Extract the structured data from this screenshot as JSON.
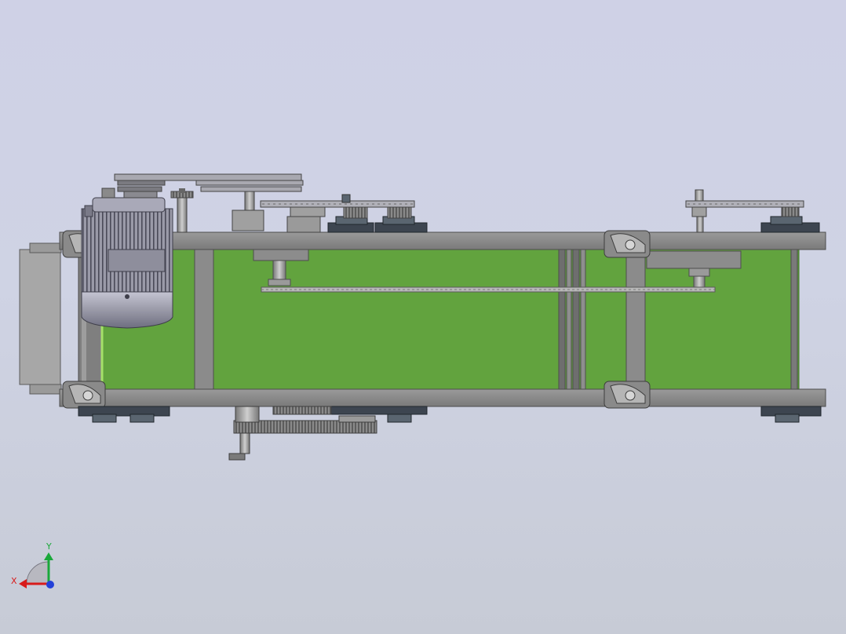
{
  "viewport": {
    "background_top": "#cfd1e6",
    "background_bottom": "#c7cbd6"
  },
  "model": {
    "frame_color": "#8a8a8a",
    "belt_color": "#62a33e",
    "motor_color": "#9a9aa8",
    "bearing_color": "#3d4550",
    "gear_color": "#7d7d7d"
  },
  "triad": {
    "x_label": "X",
    "y_label": "Y",
    "x_color": "#d81b1b",
    "y_color": "#1aa83a",
    "z_color": "#2340d8"
  }
}
